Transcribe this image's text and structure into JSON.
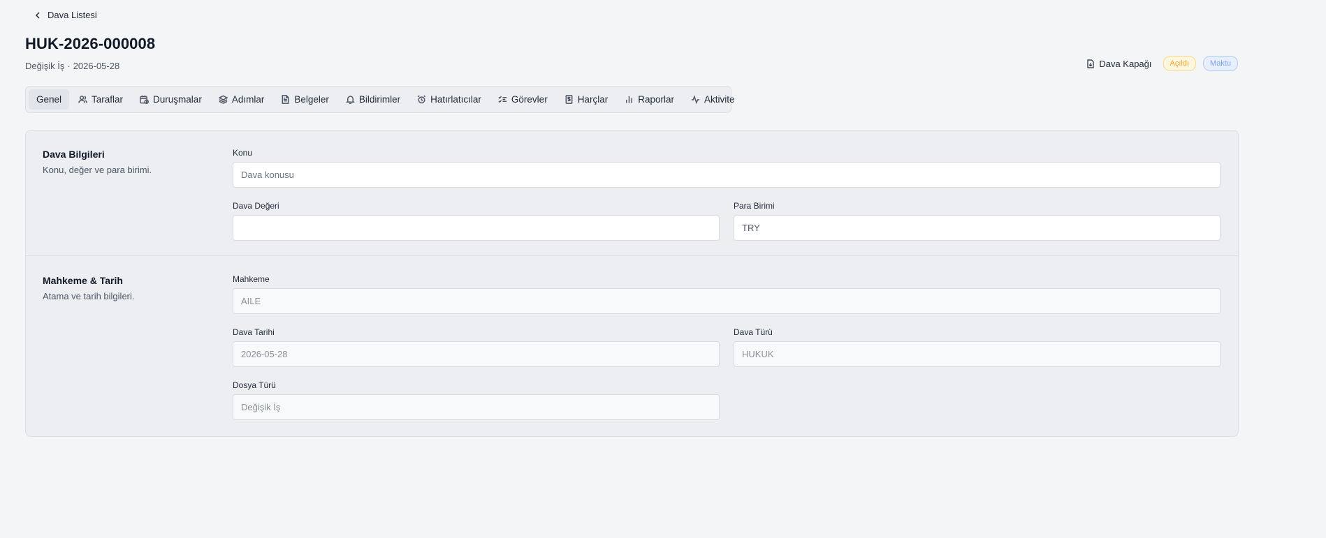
{
  "nav": {
    "back_label": "Dava Listesi"
  },
  "header": {
    "title": "HUK-2026-000008",
    "subtitle_type": "Değişik İş",
    "subtitle_sep": "·",
    "subtitle_date": "2026-05-28",
    "cover_button": "Dava Kapağı",
    "badges": [
      {
        "label": "Açıldı",
        "color": "#f5a623"
      },
      {
        "label": "Maktu",
        "color": "#7ea2e8"
      }
    ]
  },
  "tabs": [
    {
      "label": "Genel",
      "icon": "none",
      "active": true
    },
    {
      "label": "Taraflar",
      "icon": "users-icon"
    },
    {
      "label": "Duruşmalar",
      "icon": "calendar-clock-icon"
    },
    {
      "label": "Adımlar",
      "icon": "layers-icon"
    },
    {
      "label": "Belgeler",
      "icon": "file-text-icon"
    },
    {
      "label": "Bildirimler",
      "icon": "bell-icon"
    },
    {
      "label": "Hatırlatıcılar",
      "icon": "alarm-clock-icon"
    },
    {
      "label": "Görevler",
      "icon": "list-checks-icon"
    },
    {
      "label": "Harçlar",
      "icon": "receipt-icon"
    },
    {
      "label": "Raporlar",
      "icon": "bar-chart-icon"
    },
    {
      "label": "Aktivite",
      "icon": "activity-icon"
    }
  ],
  "sections": {
    "case_info": {
      "title": "Dava Bilgileri",
      "description": "Konu, değer ve para birimi.",
      "fields": {
        "subject": {
          "label": "Konu",
          "placeholder": "Dava konusu",
          "value": ""
        },
        "value": {
          "label": "Dava Değeri",
          "value": ""
        },
        "currency": {
          "label": "Para Birimi",
          "value": "TRY"
        }
      }
    },
    "court_date": {
      "title": "Mahkeme & Tarih",
      "description": "Atama ve tarih bilgileri.",
      "fields": {
        "court": {
          "label": "Mahkeme",
          "value": "AILE"
        },
        "case_date": {
          "label": "Dava Tarihi",
          "value": "2026-05-28"
        },
        "case_type": {
          "label": "Dava Türü",
          "value": "HUKUK"
        },
        "file_type": {
          "label": "Dosya Türü",
          "value": "Değişik İş"
        }
      }
    }
  }
}
